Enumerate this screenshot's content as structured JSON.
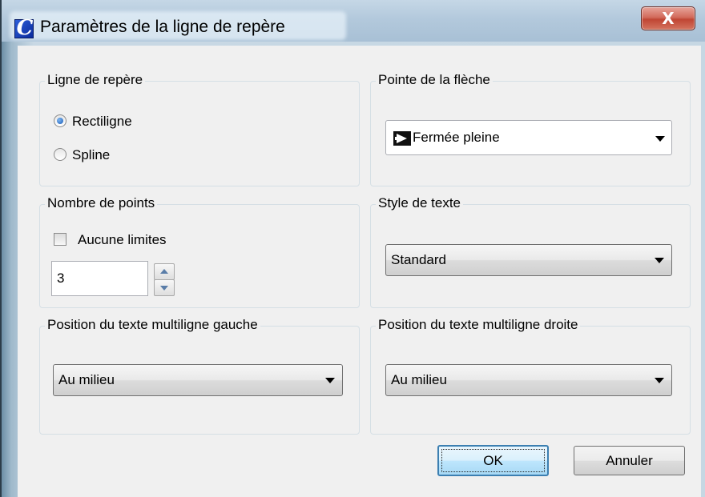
{
  "window": {
    "title": "Paramètres de la ligne de repère",
    "app_icon_letter": "C",
    "close_label": "X"
  },
  "leader_line": {
    "label": "Ligne de repère",
    "options": [
      {
        "label": "Rectiligne",
        "selected": true
      },
      {
        "label": "Spline",
        "selected": false
      }
    ]
  },
  "arrowhead": {
    "label": "Pointe de la flèche",
    "value": "Fermée pleine",
    "icon": "filled-arrow-icon"
  },
  "points": {
    "label": "Nombre de points",
    "no_limit_label": "Aucune limites",
    "no_limit_checked": false,
    "value": "3"
  },
  "text_style": {
    "label": "Style de texte",
    "value": "Standard"
  },
  "mtext_left": {
    "label": "Position du texte multiligne gauche",
    "value": "Au milieu"
  },
  "mtext_right": {
    "label": "Position du texte multiligne droite",
    "value": "Au milieu"
  },
  "buttons": {
    "ok": "OK",
    "cancel": "Annuler"
  },
  "colors": {
    "title_bar": "#b3c9dc",
    "close_button": "#c04634",
    "default_button_border": "#3c7fb1",
    "dialog_bg": "#f0f0f0"
  }
}
